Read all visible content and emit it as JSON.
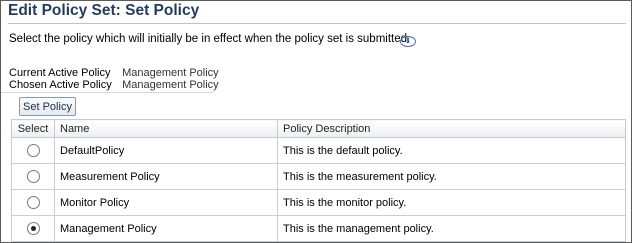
{
  "page": {
    "title": "Edit Policy Set: Set Policy",
    "instruction": "Select the policy which will initially be in effect when the policy set is submitted.",
    "info_icon": "info-icon"
  },
  "status": {
    "current_label": "Current Active Policy",
    "current_value": "Management Policy",
    "chosen_label": "Chosen Active Policy",
    "chosen_value": "Management Policy"
  },
  "toolbar": {
    "set_policy_label": "Set Policy"
  },
  "table": {
    "headers": [
      "Select",
      "Name",
      "Policy Description"
    ],
    "rows": [
      {
        "name": "DefaultPolicy",
        "description": "This is the default policy.",
        "selected": false
      },
      {
        "name": "Measurement Policy",
        "description": "This is the measurement policy.",
        "selected": false
      },
      {
        "name": "Monitor Policy",
        "description": "This is the monitor policy.",
        "selected": false
      },
      {
        "name": "Management Policy",
        "description": "This is the management policy.",
        "selected": true
      }
    ]
  }
}
